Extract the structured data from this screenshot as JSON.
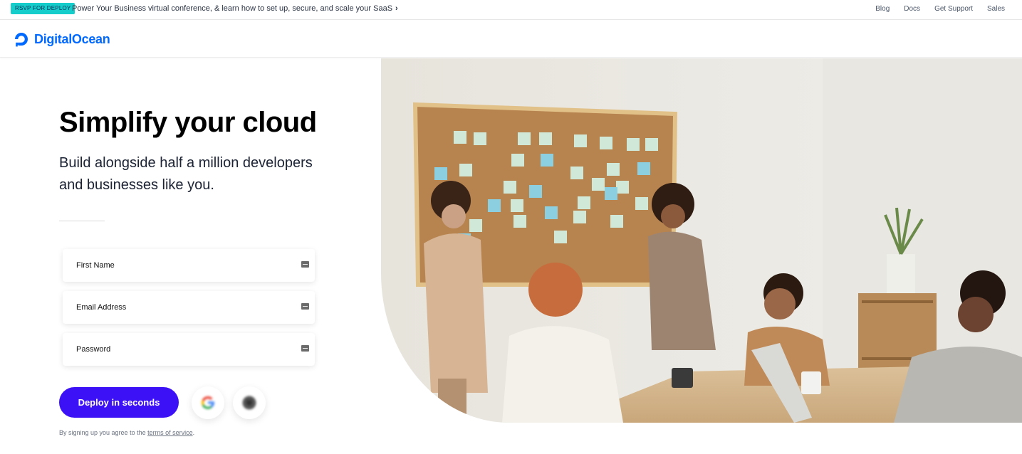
{
  "announcement": {
    "badge": "RSVP FOR DEPLOY",
    "text": "Power Your Business virtual conference, & learn how to set up, secure, and scale your SaaS",
    "chevron": "›"
  },
  "top_nav": {
    "items": [
      "Blog",
      "Docs",
      "Get Support",
      "Sales"
    ]
  },
  "brand": {
    "name": "DigitalOcean",
    "logo_icon": "digitalocean-logo-icon",
    "color": "#0069ff"
  },
  "hero": {
    "title": "Simplify your cloud",
    "subtitle": "Build alongside half a million developers and businesses like you."
  },
  "signup_form": {
    "first_name_placeholder": "First Name",
    "email_placeholder": "Email Address",
    "password_placeholder": "Password",
    "submit_label": "Deploy in seconds",
    "submit_color": "#3d11f5",
    "google_icon": "google-icon",
    "github_icon": "github-icon"
  },
  "terms": {
    "prefix": "By signing up you agree to the ",
    "link": "terms of service",
    "suffix": "."
  },
  "colors": {
    "rsvp_badge": "#15cdcb"
  }
}
